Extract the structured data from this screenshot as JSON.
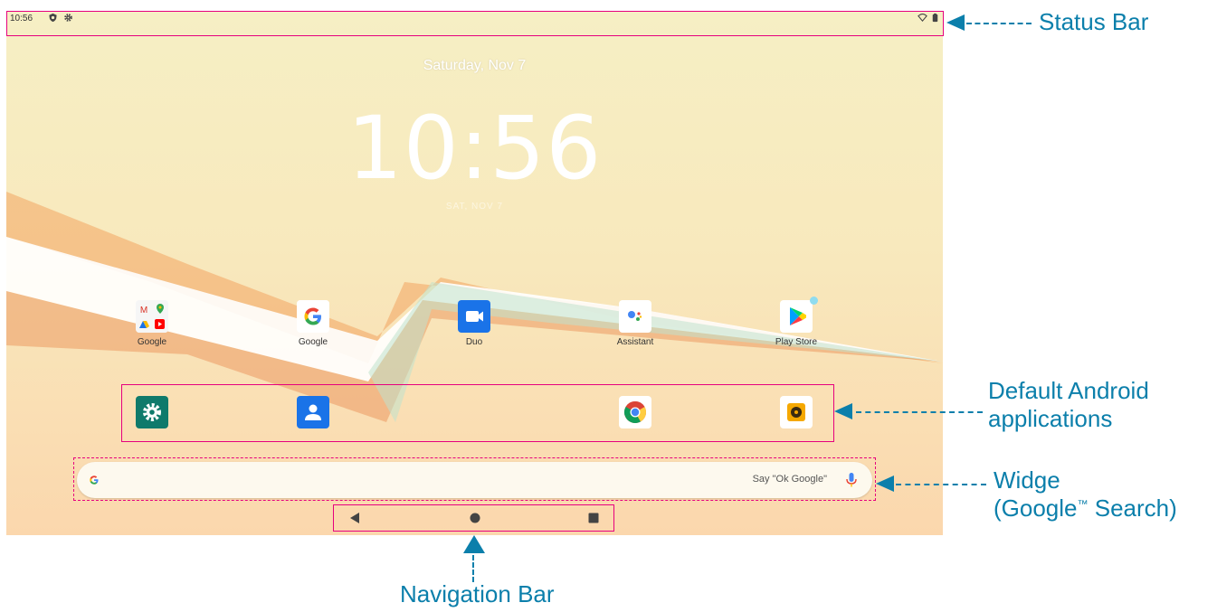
{
  "status_bar": {
    "time": "10:56"
  },
  "lockscreen": {
    "date_top": "Saturday, Nov 7",
    "clock": "10:56",
    "date_small": "SAT, NOV 7"
  },
  "apps_row1": [
    {
      "label": "Google",
      "icon": "google-folder-icon"
    },
    {
      "label": "Google",
      "icon": "google-icon"
    },
    {
      "label": "Duo",
      "icon": "duo-icon"
    },
    {
      "label": "Assistant",
      "icon": "assistant-icon"
    },
    {
      "label": "Play Store",
      "icon": "play-store-icon"
    }
  ],
  "apps_row2": [
    {
      "icon": "settings-icon"
    },
    {
      "icon": "contacts-icon"
    },
    {
      "icon": "chrome-icon"
    },
    {
      "icon": "music-icon"
    }
  ],
  "search": {
    "hint": "Say \"Ok Google\""
  },
  "callouts": {
    "status_bar": "Status Bar",
    "default_apps_line1": "Default Android",
    "default_apps_line2": "applications",
    "widget_line1": "Widge",
    "widget_line2_a": "(Google",
    "widget_tm": "™",
    "widget_line2_b": " Search)",
    "navigation_bar": "Navigation Bar"
  },
  "colors": {
    "accent": "#0b7fab",
    "highlight": "#e6007e"
  }
}
